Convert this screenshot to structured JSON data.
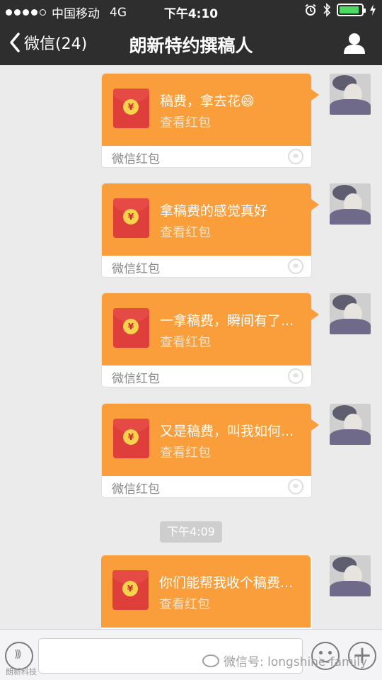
{
  "status_bar": {
    "carrier": "中国移动",
    "network": "4G",
    "time": "下午4:10",
    "battery_level": 0.9
  },
  "nav": {
    "back_label": "微信(24)",
    "title": "朗新特约撰稿人"
  },
  "messages": [
    {
      "text": "稿费，拿去花😄",
      "action": "查看红包",
      "footer": "微信红包"
    },
    {
      "text": "拿稿费的感觉真好",
      "action": "查看红包",
      "footer": "微信红包"
    },
    {
      "text": "一拿稿费，瞬间有了...",
      "action": "查看红包",
      "footer": "微信红包"
    },
    {
      "text": "又是稿费，叫我如何...",
      "action": "查看红包",
      "footer": "微信红包"
    },
    {
      "text": "你们能帮我收个稿费...",
      "action": "查看红包",
      "footer": ""
    }
  ],
  "time_divider": "下午4:09",
  "input_bar": {
    "placeholder": ""
  },
  "watermark": {
    "text": "微信号: longshine-family",
    "small": "朗新科技"
  },
  "colors": {
    "red_packet": "#fa9d3b",
    "nav_bg": "#2e2e2e",
    "chat_bg": "#ebebeb"
  },
  "icons": [
    "back-chevron-icon",
    "user-icon",
    "voice-icon",
    "emoji-icon",
    "plus-icon",
    "alarm-icon",
    "bluetooth-icon",
    "battery-icon",
    "charging-icon"
  ]
}
